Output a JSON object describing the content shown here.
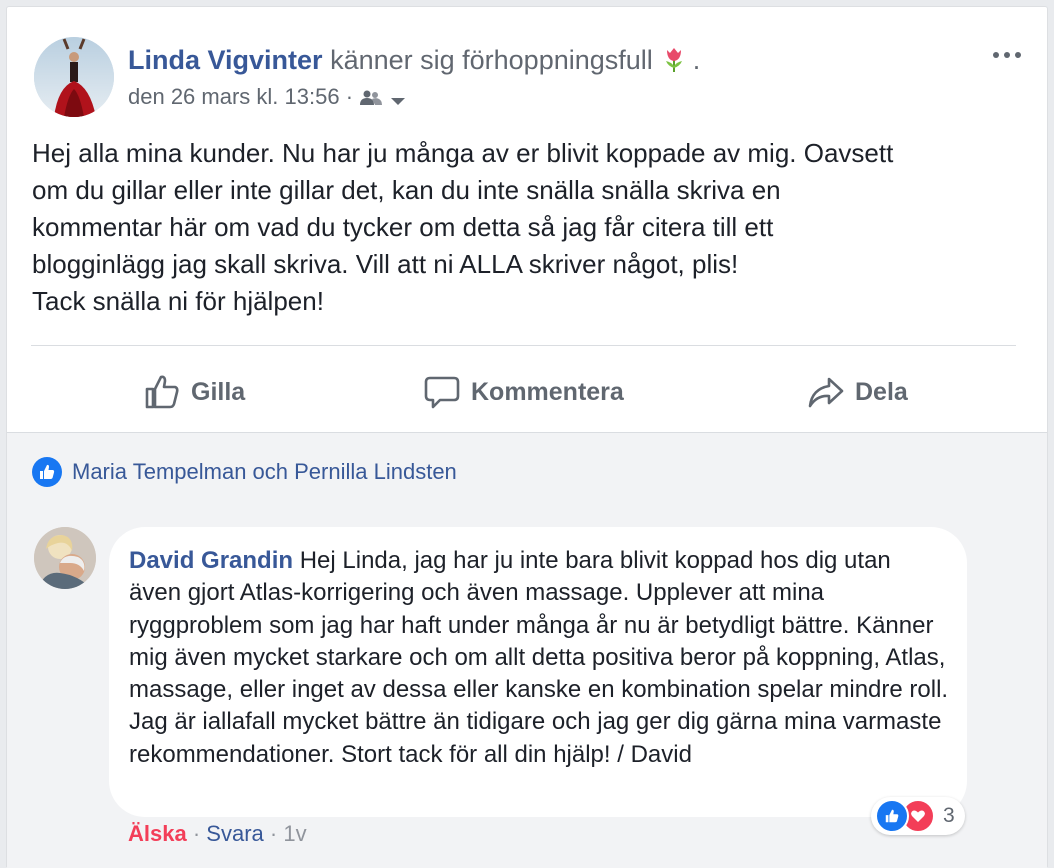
{
  "post": {
    "author": "Linda Vigvinter",
    "feeling": "känner sig förhoppningsfull",
    "feeling_suffix": ".",
    "timestamp": "den 26 mars kl. 13:56",
    "separator": "·",
    "text_lines": [
      "Hej alla mina kunder. Nu har ju många av er blivit koppade av mig. Oavsett",
      "om du gillar eller inte gillar det, kan du inte snälla snälla skriva en",
      "kommentar här om vad du tycker om detta så jag får citera till ett",
      "blogginlägg jag skall skriva. Vill att ni ALLA skriver något, plis!",
      "Tack snälla ni för hjälpen!"
    ]
  },
  "actions": {
    "like": "Gilla",
    "comment": "Kommentera",
    "share": "Dela"
  },
  "likes": {
    "text": "Maria Tempelman och Pernilla Lindsten"
  },
  "comment": {
    "author": "David Grandin",
    "text": "Hej Linda, jag har ju inte bara blivit koppad hos dig utan även gjort Atlas-korrigering och även massage. Upplever att mina ryggproblem som jag har haft under många år nu är betydligt bättre. Känner mig även mycket starkare och om allt detta positiva beror på koppning, Atlas, massage, eller inget av dessa eller kanske en kombination spelar mindre roll. Jag är iallafall mycket bättre än tidigare och jag ger dig gärna mina varmaste rekommendationer. Stort tack för all din hjälp! / David",
    "reaction_count": "3",
    "love_label": "Älska",
    "reply_label": "Svara",
    "age": "1v",
    "sep": "·"
  },
  "colors": {
    "link": "#385898",
    "love": "#f33e58",
    "like_blue": "#1877f2"
  }
}
